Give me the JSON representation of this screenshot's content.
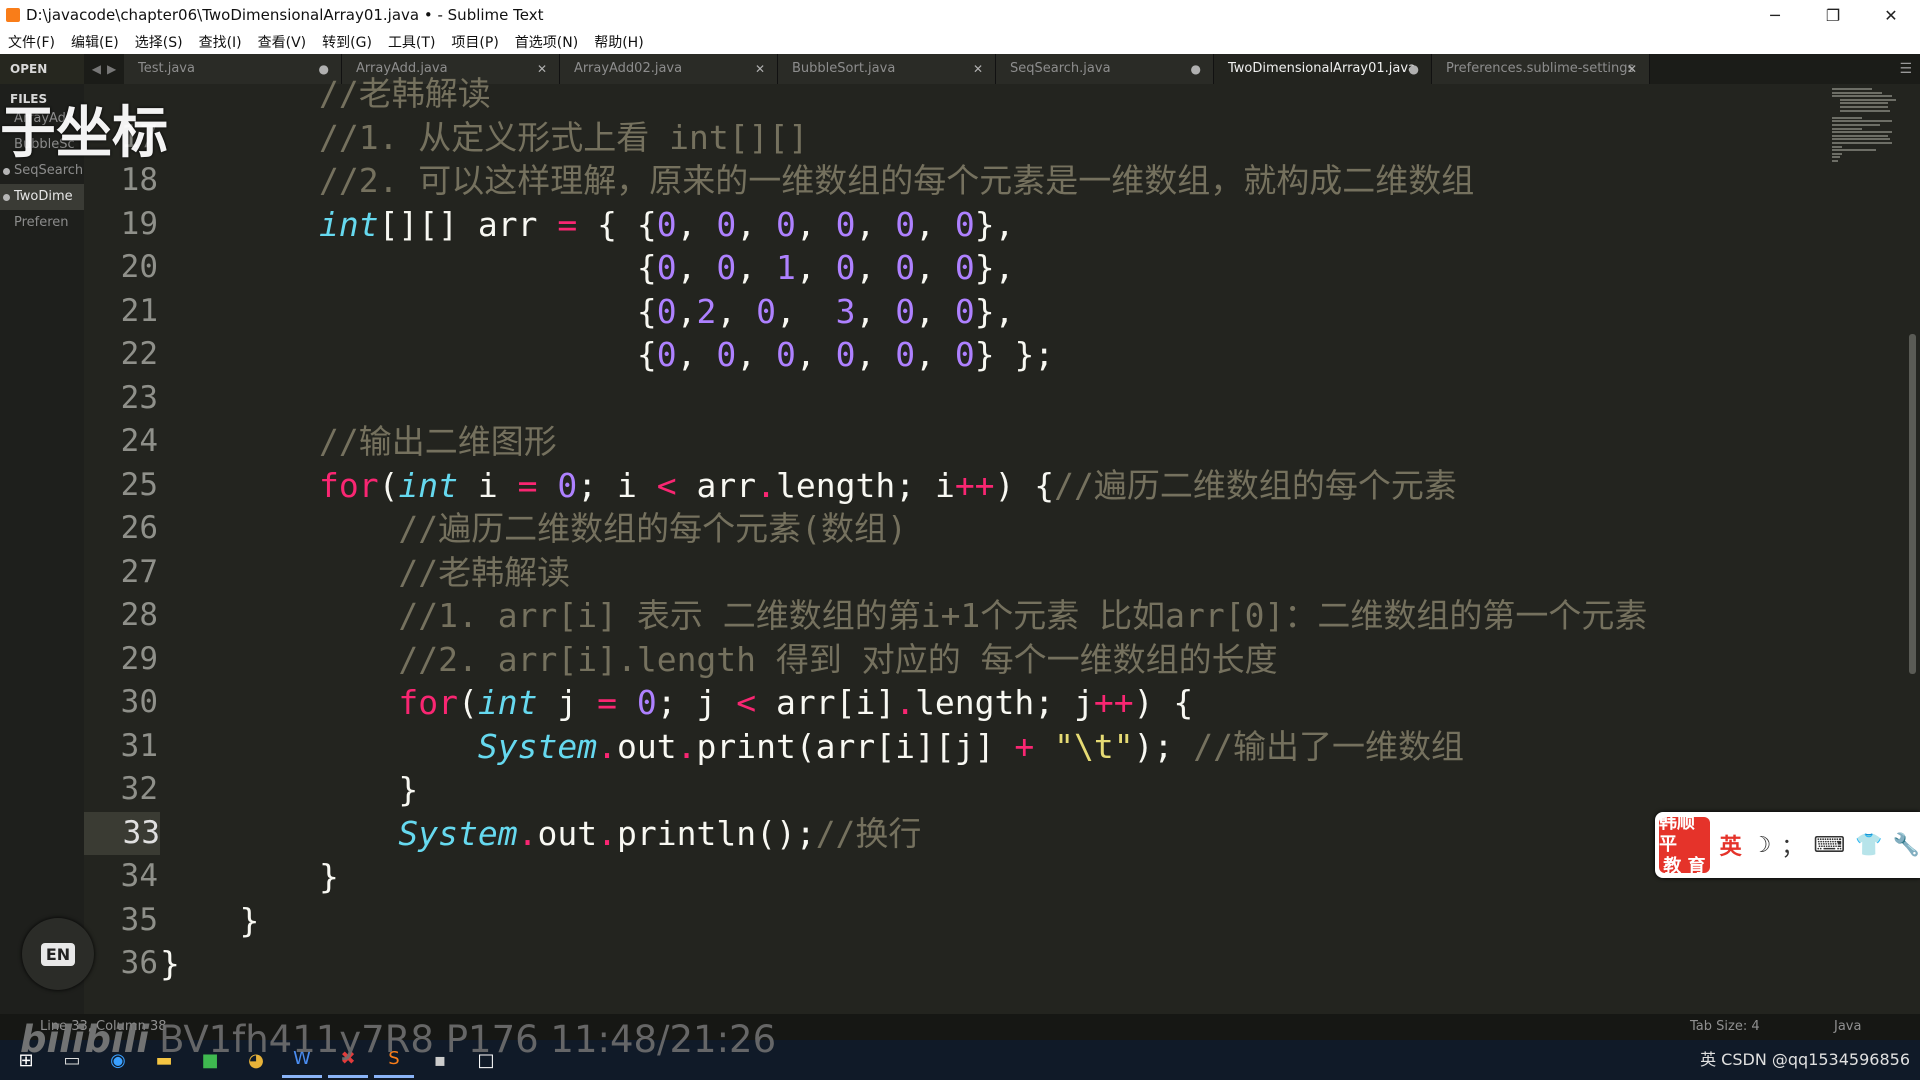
{
  "window": {
    "title": "D:\\javacode\\chapter06\\TwoDimensionalArray01.java • - Sublime Text",
    "controls": [
      "─",
      "❐",
      "✕"
    ]
  },
  "menu": [
    "文件(F)",
    "编辑(E)",
    "选择(S)",
    "查找(I)",
    "查看(V)",
    "转到(G)",
    "工具(T)",
    "项目(P)",
    "首选项(N)",
    "帮助(H)"
  ],
  "overlay": {
    "text": "于坐标"
  },
  "sidebar": {
    "header": "OPEN FILES",
    "files": [
      {
        "label": "ArrayAdd",
        "active": false,
        "dot": false
      },
      {
        "label": "BubbleSc",
        "active": false,
        "dot": false
      },
      {
        "label": "SeqSearch",
        "active": false,
        "dot": true
      },
      {
        "label": "TwoDime",
        "active": true,
        "dot": true
      },
      {
        "label": "Preferen",
        "active": false,
        "dot": false
      }
    ]
  },
  "tabs": [
    {
      "label": "Test.java",
      "close": "●",
      "active": false
    },
    {
      "label": "ArrayAdd.java",
      "close": "✕",
      "active": false
    },
    {
      "label": "ArrayAdd02.java",
      "close": "✕",
      "active": false
    },
    {
      "label": "BubbleSort.java",
      "close": "✕",
      "active": false
    },
    {
      "label": "SeqSearch.java",
      "close": "●",
      "active": false
    },
    {
      "label": "TwoDimensionalArray01.java",
      "close": "●",
      "active": true
    },
    {
      "label": "Preferences.sublime-settings",
      "close": "✕",
      "active": false
    }
  ],
  "code": {
    "current_line": "33",
    "lines": [
      {
        "no": "",
        "html": "        <span class='c'>//老韩解读</span>"
      },
      {
        "no": "17",
        "html": "        <span class='c'>//1. 从定义形式上看 int[][]</span>"
      },
      {
        "no": "18",
        "html": "        <span class='c'>//2. 可以这样理解，原来的一维数组的每个元素是一维数组，就构成二维数组</span>"
      },
      {
        "no": "19",
        "html": "        <span class='t'>int</span>[][] arr <span class='o'>=</span> { {<span class='n'>0</span>, <span class='n'>0</span>, <span class='n'>0</span>, <span class='n'>0</span>, <span class='n'>0</span>, <span class='n'>0</span>},"
      },
      {
        "no": "20",
        "html": "                        {<span class='n'>0</span>, <span class='n'>0</span>, <span class='n'>1</span>, <span class='n'>0</span>, <span class='n'>0</span>, <span class='n'>0</span>},"
      },
      {
        "no": "21",
        "html": "                        {<span class='n'>0</span>,<span class='n'>2</span>, <span class='n'>0</span>,  <span class='n'>3</span>, <span class='n'>0</span>, <span class='n'>0</span>},"
      },
      {
        "no": "22",
        "html": "                        {<span class='n'>0</span>, <span class='n'>0</span>, <span class='n'>0</span>, <span class='n'>0</span>, <span class='n'>0</span>, <span class='n'>0</span>} };"
      },
      {
        "no": "23",
        "html": ""
      },
      {
        "no": "24",
        "html": "        <span class='c'>//输出二维图形</span>"
      },
      {
        "no": "25",
        "html": "        <span class='k'>for</span>(<span class='t'>int</span> i <span class='o'>=</span> <span class='n'>0</span>; i <span class='o'>&lt;</span> arr<span class='o'>.</span>length; i<span class='o'>++</span>) {<span class='c'>//遍历二维数组的每个元素</span>"
      },
      {
        "no": "26",
        "html": "            <span class='c'>//遍历二维数组的每个元素(数组)</span>"
      },
      {
        "no": "27",
        "html": "            <span class='c'>//老韩解读</span>"
      },
      {
        "no": "28",
        "html": "            <span class='c'>//1. arr[i] 表示 二维数组的第i+1个元素 比如arr[0]：二维数组的第一个元素</span>"
      },
      {
        "no": "29",
        "html": "            <span class='c'>//2. arr[i].length 得到 对应的 每个一维数组的长度</span>"
      },
      {
        "no": "30",
        "html": "            <span class='k'>for</span>(<span class='t'>int</span> j <span class='o'>=</span> <span class='n'>0</span>; j <span class='o'>&lt;</span> arr[i]<span class='o'>.</span>length; j<span class='o'>++</span>) {"
      },
      {
        "no": "31",
        "html": "                <span class='t'>System</span><span class='o'>.</span>out<span class='o'>.</span>print(arr[i][j] <span class='o'>+</span> <span class='s'>\"\\t\"</span>); <span class='c'>//输出了一维数组</span>"
      },
      {
        "no": "32",
        "html": "            }"
      },
      {
        "no": "33",
        "html": "            <span class='t'>System</span><span class='o'>.</span>out<span class='o'>.</span>println();<span class='c'>//换行</span>"
      },
      {
        "no": "34",
        "html": "        }"
      },
      {
        "no": "35",
        "html": "    }"
      },
      {
        "no": "36",
        "html": "}"
      }
    ]
  },
  "ime": {
    "logo_line1": "韩顺平",
    "logo_line2": "教 育",
    "lang": "英",
    "moon": "☽",
    "punct": "；",
    "keyboard": "⌨",
    "shirt": "👕",
    "tool": "🔧"
  },
  "en_badge": "EN",
  "status": {
    "position": "Line 33, Column 38",
    "tab_size": "Tab Size: 4",
    "syntax": "Java"
  },
  "video_id": {
    "logo": "bilibili",
    "text": "BV1fh411y7R8 P176 11:48/21:26"
  },
  "tray_text": "英  CSDN @qq1534596856"
}
